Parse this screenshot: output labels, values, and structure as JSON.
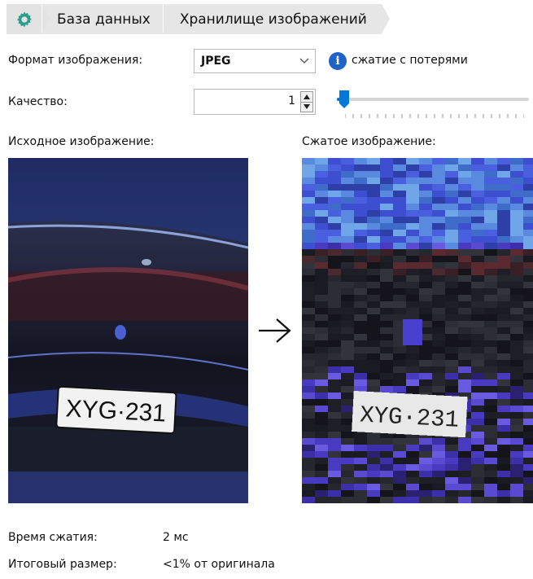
{
  "breadcrumb": {
    "items": [
      "База данных",
      "Хранилище изображений"
    ]
  },
  "format": {
    "label": "Формат изображения:",
    "value": "JPEG",
    "note": "сжатие с потерями"
  },
  "quality": {
    "label": "Качество:",
    "value": "1",
    "level": 0.01
  },
  "images": {
    "original_label": "Исходное изображение:",
    "compressed_label": "Сжатое изображение:",
    "plate_text": "XYG·231"
  },
  "stats": {
    "time_label": "Время сжатия:",
    "time_value": "2 мс",
    "size_label": "Итоговый размер:",
    "size_value": "<1% от оригинала"
  },
  "colors": {
    "accent": "#0078d7",
    "gear": "#2a9d8f",
    "info": "#1f63c6"
  }
}
